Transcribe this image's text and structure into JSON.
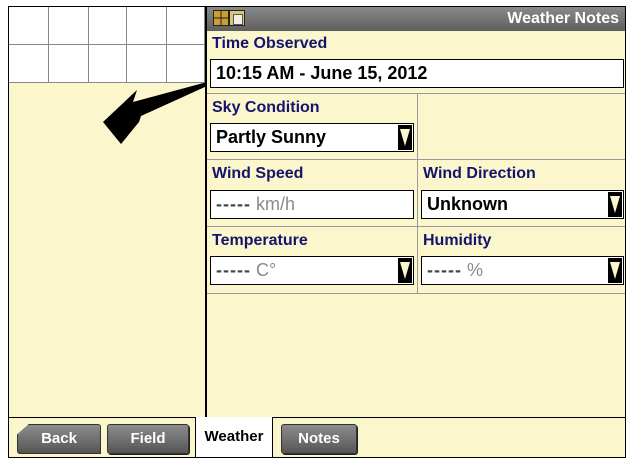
{
  "window": {
    "title": "Weather Notes",
    "icons": [
      "grid-map-icon",
      "notes-icon"
    ]
  },
  "form": {
    "time_observed": {
      "label": "Time Observed",
      "value": "10:15 AM - June 15, 2012"
    },
    "sky_condition": {
      "label": "Sky Condition",
      "value": "Partly Sunny"
    },
    "wind_speed": {
      "label": "Wind Speed",
      "placeholder_dashes": "-----",
      "unit": "km/h"
    },
    "wind_direction": {
      "label": "Wind Direction",
      "value": "Unknown"
    },
    "temperature": {
      "label": "Temperature",
      "placeholder_dashes": "-----",
      "unit": "C°"
    },
    "humidity": {
      "label": "Humidity",
      "placeholder_dashes": "-----",
      "unit": "%"
    }
  },
  "tabs": {
    "back": "Back",
    "field": "Field",
    "weather": "Weather",
    "notes": "Notes",
    "active": "weather"
  },
  "colors": {
    "panel_bg": "#fbf6cc",
    "label_text": "#14146e",
    "titlebar": "#6e6e6e",
    "arrow": "#000000"
  }
}
